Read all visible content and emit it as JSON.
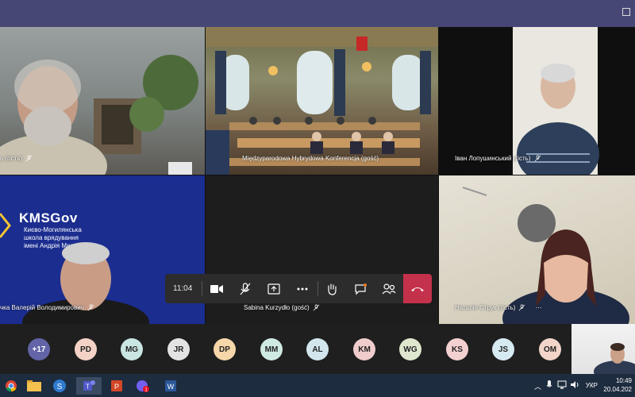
{
  "window": {
    "accent": "#464775"
  },
  "tiles": [
    {
      "name_label": "ь (гість)"
    },
    {
      "name_label": "Międzyparodowa Hybrydowa Konferencja (gość)"
    },
    {
      "name_label": "Іван Лопушинський (гість)"
    },
    {
      "name_label": "чка Валерій Володимирович",
      "logo_title": "KMSGov",
      "logo_sub": "Києво-Могилянська школа врядування імені Андрія Мел"
    },
    {
      "name_label": "Sabina Kurzydło (gość)"
    },
    {
      "name_label": "Наталія Струк (гість)"
    }
  ],
  "controls": {
    "time": "11:04"
  },
  "avatars": [
    {
      "initials": "+17",
      "color": "#6264a7",
      "text_color": "#ffffff"
    },
    {
      "initials": "PD",
      "color": "#f4d3c6"
    },
    {
      "initials": "MG",
      "color": "#c9e6e3"
    },
    {
      "initials": "JR",
      "color": "#e3e3e3"
    },
    {
      "initials": "DP",
      "color": "#f6d7a9"
    },
    {
      "initials": "MM",
      "color": "#cfeae3"
    },
    {
      "initials": "AL",
      "color": "#d3e6ee"
    },
    {
      "initials": "KM",
      "color": "#f0cccc"
    },
    {
      "initials": "WG",
      "color": "#dfe8cf"
    },
    {
      "initials": "KS",
      "color": "#f4d1d1"
    },
    {
      "initials": "JS",
      "color": "#d6eaf2"
    },
    {
      "initials": "OM",
      "color": "#f2d4c8"
    }
  ],
  "taskbar": {
    "language": "УКР",
    "time": "10:49",
    "date": "20.04.202",
    "teams_badge": "1"
  }
}
